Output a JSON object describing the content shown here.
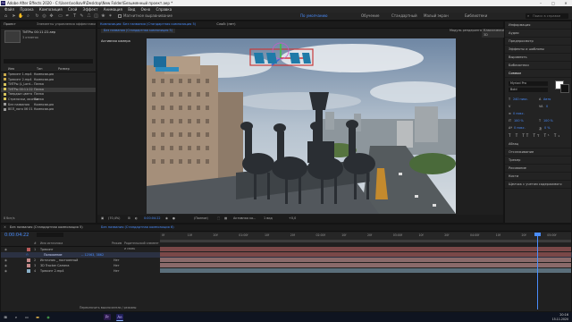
{
  "window": {
    "title": "Adobe After Effects 2020 - C:\\Users\\volkov9\\Desktop\\New Folder\\Безымянный проект.aep *",
    "logo": "Ae"
  },
  "menu": [
    "Файл",
    "Правка",
    "Композиция",
    "Слой",
    "Эффект",
    "Анимация",
    "Вид",
    "Окно",
    "Справка"
  ],
  "toolbar": {
    "snap_label": "Магнитное выравнивание",
    "workspaces": [
      "По умолчанию",
      "Обучение",
      "Стандартный",
      "Малый экран",
      "Библиотеки"
    ],
    "active_workspace": "По умолчанию",
    "search_placeholder": "Поиск в справке"
  },
  "project": {
    "tab_label": "Проект",
    "effects_tab": "Элементы управления эффектами: Трекинг 2.mp4",
    "selected_name": "ТИТРы 00:11:22.aep",
    "selected_info": "3 отметок",
    "header": {
      "name": "Имя",
      "type": "Тип",
      "size": "Размер"
    },
    "items": [
      {
        "name": "Трекинг 1.mp4",
        "type": "Композиция",
        "size": "",
        "color": "#c9a94a"
      },
      {
        "name": "Трекинг 2.mp4",
        "type": "Композиция",
        "size": "",
        "color": "#c9a94a"
      },
      {
        "name": "ТИТРы (L_Lord...",
        "type": "Папка",
        "size": "",
        "color": "#d6c35b"
      },
      {
        "name": "ТИТРы 00:11:22",
        "type": "Папка",
        "size": "",
        "color": "#d6c35b"
      },
      {
        "name": "Твердые цвета",
        "type": "Папка",
        "size": "",
        "color": "#d6c35b"
      },
      {
        "name": "Стрелочки, иконки",
        "type": "Папка",
        "size": "",
        "color": "#d6c35b"
      },
      {
        "name": "Без названия",
        "type": "Композиция",
        "size": "",
        "color": "#9a9a9a"
      },
      {
        "name": "ВЕЛ_лого 06 01",
        "type": "Композиция",
        "size": "",
        "color": "#9a9a9a"
      }
    ],
    "footer_bpc": "8 бит/к"
  },
  "composition": {
    "tabs": [
      "Композиция: Без названия (Стандартная композиция 5)",
      "Слой: (нет)"
    ],
    "breadcrumb": "Без названия (Стандартная композиция 5)",
    "renderer_label": "Модуль рендеринга:",
    "renderer_value": "Классический 3D",
    "camera_label": "Активная камера",
    "viewer_footer": {
      "zoom": "(70,4%)",
      "time": "0:00:04:22",
      "resolution": "(Полное)",
      "camera": "Активная ка...",
      "views": "1 вид",
      "exposure": "+0,0"
    }
  },
  "right_panel": {
    "items": [
      "Информация",
      "Аудио",
      "Предпросмотр",
      "Эффекты и шаблоны",
      "Выровнять",
      "Библиотеки",
      "Символ"
    ],
    "character": {
      "font": "Myriad Pro",
      "style": "Bold",
      "size": "240 пикс.",
      "leading": "Авто",
      "tracking": "0",
      "stroke": "0 пикс.",
      "percent_a": "100 %",
      "percent_b": "100 %",
      "baseline": "0 пикс.",
      "tsume": "0 %"
    },
    "bottom_items": [
      "Абзац",
      "Отслеживание",
      "Трекер",
      "Рисование",
      "Кисти",
      "Щелчок с учетом содержимого"
    ]
  },
  "timeline": {
    "tabs": [
      "Без названия (Стандартная композиция 5)",
      "Без названия (Стандартная композиция 6)"
    ],
    "current_time": "0:00:04:22",
    "header": {
      "num": "#",
      "name": "Имя источника",
      "mode": "Режим",
      "parent": "Родительский элемент и связь"
    },
    "ruler": [
      "0f",
      "10f",
      "20f",
      "01:00f",
      "10f",
      "20f",
      "02:00f",
      "10f",
      "20f",
      "03:00f",
      "10f",
      "20f",
      "04:00f",
      "10f",
      "20f",
      "05:00f"
    ],
    "layers": [
      {
        "num": "1",
        "name": "Трекинг",
        "mode": "",
        "parent": "",
        "color": "#b85a5a",
        "selected": false
      },
      {
        "num": "",
        "name": "Положение",
        "mode": "",
        "parent": "-- 12563, 3862",
        "color": "#4a8dfd",
        "selected": true
      },
      {
        "num": "2",
        "name": "Источник _ постоянный",
        "mode": "Нет",
        "parent": "",
        "color": "#c38a8a",
        "selected": false
      },
      {
        "num": "3",
        "name": "3D Tracker Camera",
        "mode": "Нет",
        "parent": "",
        "color": "#c38a8a",
        "selected": false
      },
      {
        "num": "4",
        "name": "Трекинг 2.mp4",
        "mode": "Нет",
        "parent": "",
        "color": "#8ab0c8",
        "selected": false
      }
    ],
    "footer": "Переключить выключатели / режимы"
  },
  "taskbar": {
    "apps": [
      "Start",
      "Search",
      "TaskView",
      "Explorer",
      "Chrome",
      "Premiere",
      "AfterEffects"
    ],
    "time": "20:16",
    "date": "15.11.2020"
  }
}
